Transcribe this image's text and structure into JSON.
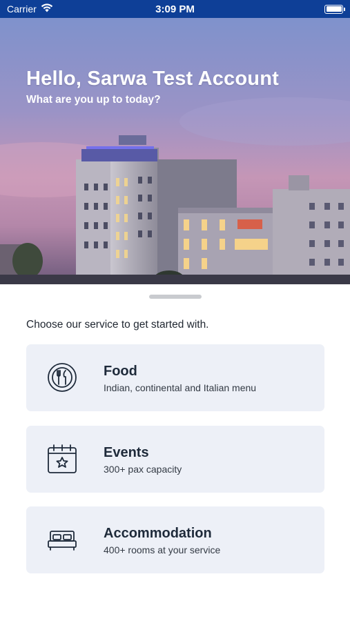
{
  "status_bar": {
    "carrier": "Carrier",
    "time": "3:09 PM"
  },
  "hero": {
    "greeting": "Hello, Sarwa Test Account",
    "subtitle": "What are you up to today?"
  },
  "main": {
    "prompt": "Choose our service to get started with.",
    "services": [
      {
        "title": "Food",
        "description": "Indian, continental and Italian menu",
        "icon": "plate-fork-spoon-icon"
      },
      {
        "title": "Events",
        "description": "300+ pax capacity",
        "icon": "calendar-star-icon"
      },
      {
        "title": "Accommodation",
        "description": "400+ rooms at your service",
        "icon": "bed-icon"
      }
    ]
  },
  "colors": {
    "status_bar": "#0e3f97",
    "card_bg": "#edf0f7",
    "text_dark": "#1e2a3a"
  }
}
